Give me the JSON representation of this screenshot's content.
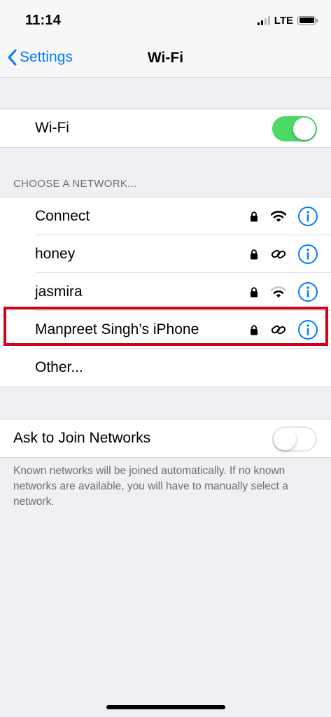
{
  "status_bar": {
    "time": "11:14",
    "carrier_type": "LTE"
  },
  "nav": {
    "back_label": "Settings",
    "title": "Wi-Fi"
  },
  "wifi": {
    "label": "Wi-Fi",
    "enabled": true,
    "toggle_color": "#4cd964"
  },
  "networks_section": {
    "header": "CHOOSE A NETWORK...",
    "items": [
      {
        "name": "Connect",
        "secured": true,
        "signal_icon": "wifi-signal-icon"
      },
      {
        "name": "honey",
        "secured": true,
        "signal_icon": "personal-hotspot-icon"
      },
      {
        "name": "jasmira",
        "secured": true,
        "signal_icon": "wifi-signal-icon"
      },
      {
        "name": "Manpreet Singh’s iPhone",
        "secured": true,
        "signal_icon": "personal-hotspot-icon",
        "highlighted": true
      }
    ],
    "other_label": "Other..."
  },
  "ask_to_join": {
    "label": "Ask to Join Networks",
    "enabled": false,
    "note": "Known networks will be joined automatically. If no known networks are available, you will have to manually select a network."
  },
  "colors": {
    "accent": "#007aff",
    "highlight_border": "#d0021b",
    "background": "#efeff4"
  }
}
